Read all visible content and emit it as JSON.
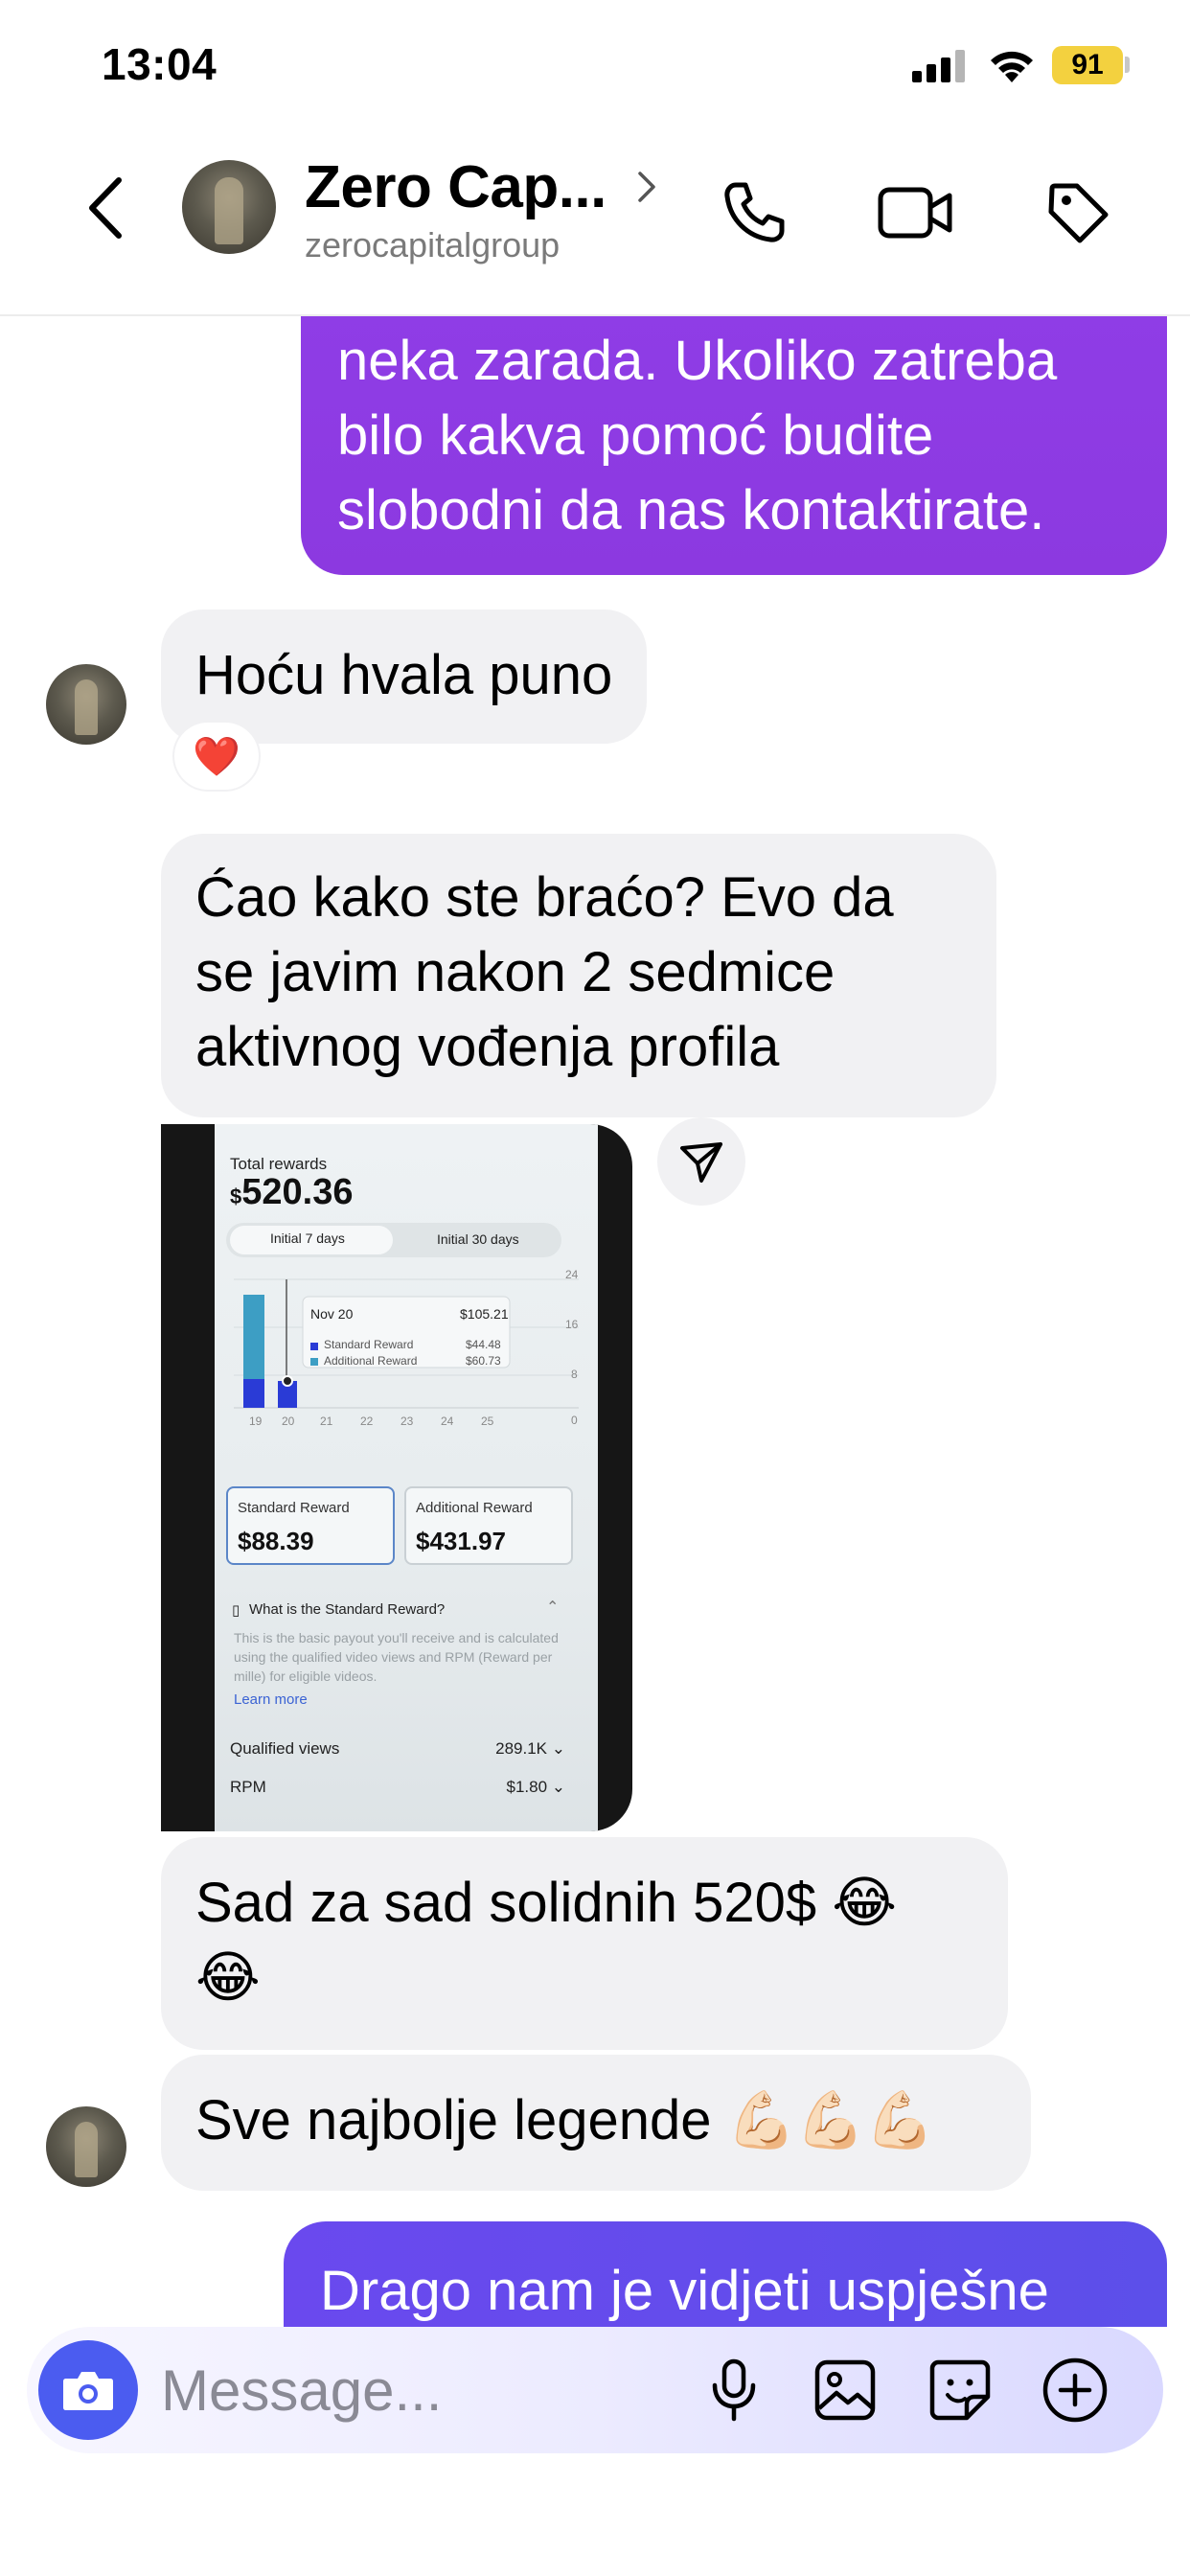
{
  "status_bar": {
    "time": "13:04",
    "battery": "91",
    "battery_color": "#F3D13F"
  },
  "header": {
    "contact_name": "Zero Cap...",
    "contact_handle": "zerocapitalgroup",
    "icons": [
      "chevron-left-icon",
      "chevron-right-icon",
      "phone-icon",
      "video-icon",
      "tag-icon"
    ]
  },
  "colors": {
    "outgoing_bubble": "#8C39E0",
    "outgoing_bubble_blue": "#5C4FEA",
    "incoming_bubble": "#F1F1F3",
    "accent": "#4B5CF0"
  },
  "messages": [
    {
      "direction": "outgoing",
      "lines": [
        "neka zarada. Ukoliko zatreba",
        "bilo kakva pomoć budite",
        "slobodni da nas kontaktirate."
      ]
    },
    {
      "direction": "incoming",
      "text": "Hoću hvala puno",
      "reaction": "❤️"
    },
    {
      "direction": "incoming",
      "lines": [
        "Ćao kako ste braćo? Evo da",
        "se javim nakon 2 sedmice",
        "aktivnog vođenja profila"
      ]
    },
    {
      "direction": "incoming",
      "type": "image",
      "screenshot": {
        "total_label": "Total rewards",
        "total_currency": "$",
        "total_value": "520.36",
        "tab_1": "Initial 7 days",
        "tab_2": "Initial 30 days",
        "y_ticks": [
          "24",
          "16",
          "8",
          "0"
        ],
        "x_ticks": [
          "19",
          "20",
          "21",
          "22",
          "23",
          "24",
          "25"
        ],
        "tooltip_date": "Nov 20",
        "tooltip_total": "$105.21",
        "tooltip_standard_label": "Standard Reward",
        "tooltip_standard_value": "$44.48",
        "tooltip_additional_label": "Additional Reward",
        "tooltip_additional_value": "$60.73",
        "card_standard_label": "Standard Reward",
        "card_standard_value": "$88.39",
        "card_additional_label": "Additional Reward",
        "card_additional_value": "$431.97",
        "faq_title": "What is the Standard Reward?",
        "faq_body": "This is the basic payout you'll receive and is calculated using the qualified video views and RPM (Reward per mille) for eligible videos.",
        "learn_more": "Learn more",
        "qualified_views_label": "Qualified views",
        "qualified_views_value": "289.1K",
        "rpm_label": "RPM",
        "rpm_value": "$1.80"
      }
    },
    {
      "direction": "incoming",
      "lines": [
        "Sad za sad solidnih 520$ 😂",
        "😂"
      ]
    },
    {
      "direction": "incoming",
      "text": "Sve najbolje legende 💪🏻💪🏻💪🏻"
    },
    {
      "direction": "outgoing",
      "text": "Drago nam je vidjeti uspješne"
    }
  ],
  "composer": {
    "placeholder": "Message...",
    "icons": [
      "camera-icon",
      "microphone-icon",
      "gallery-icon",
      "sticker-icon",
      "plus-circle-icon"
    ]
  }
}
